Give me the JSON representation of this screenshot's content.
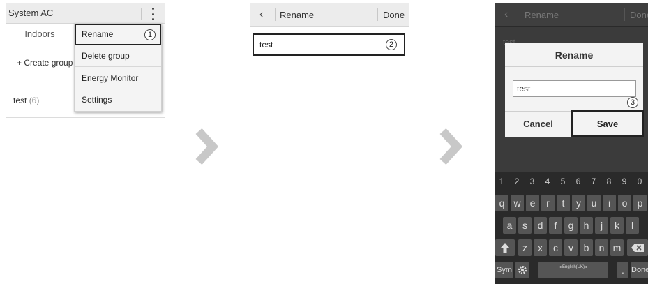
{
  "screen1": {
    "title": "System AC",
    "tab_label": "Indoors",
    "create_group": "+ Create group",
    "group_name": "test",
    "group_count": "(6)",
    "menu": [
      {
        "label": "Rename",
        "step": "1"
      },
      {
        "label": "Delete group"
      },
      {
        "label": "Energy Monitor"
      },
      {
        "label": "Settings"
      }
    ]
  },
  "screen2": {
    "title": "Rename",
    "done": "Done",
    "back_icon": "‹",
    "field_value": "test",
    "step": "2"
  },
  "screen3": {
    "title": "Rename",
    "done": "Done",
    "back_icon": "‹",
    "behind_text": "test",
    "dialog": {
      "title": "Rename",
      "input_value": "test",
      "step": "3",
      "cancel": "Cancel",
      "save": "Save"
    },
    "keyboard": {
      "numbers": [
        "1",
        "2",
        "3",
        "4",
        "5",
        "6",
        "7",
        "8",
        "9",
        "0"
      ],
      "row1": [
        "q",
        "w",
        "e",
        "r",
        "t",
        "y",
        "u",
        "i",
        "o",
        "p"
      ],
      "row2": [
        "a",
        "s",
        "d",
        "f",
        "g",
        "h",
        "j",
        "k",
        "l"
      ],
      "row3": [
        "z",
        "x",
        "c",
        "v",
        "b",
        "n",
        "m"
      ],
      "sym": "Sym",
      "space_label": "◂ English(UK) ▸",
      "period": ".",
      "done": "Done"
    }
  },
  "arrow_color": "#c8c8c8"
}
